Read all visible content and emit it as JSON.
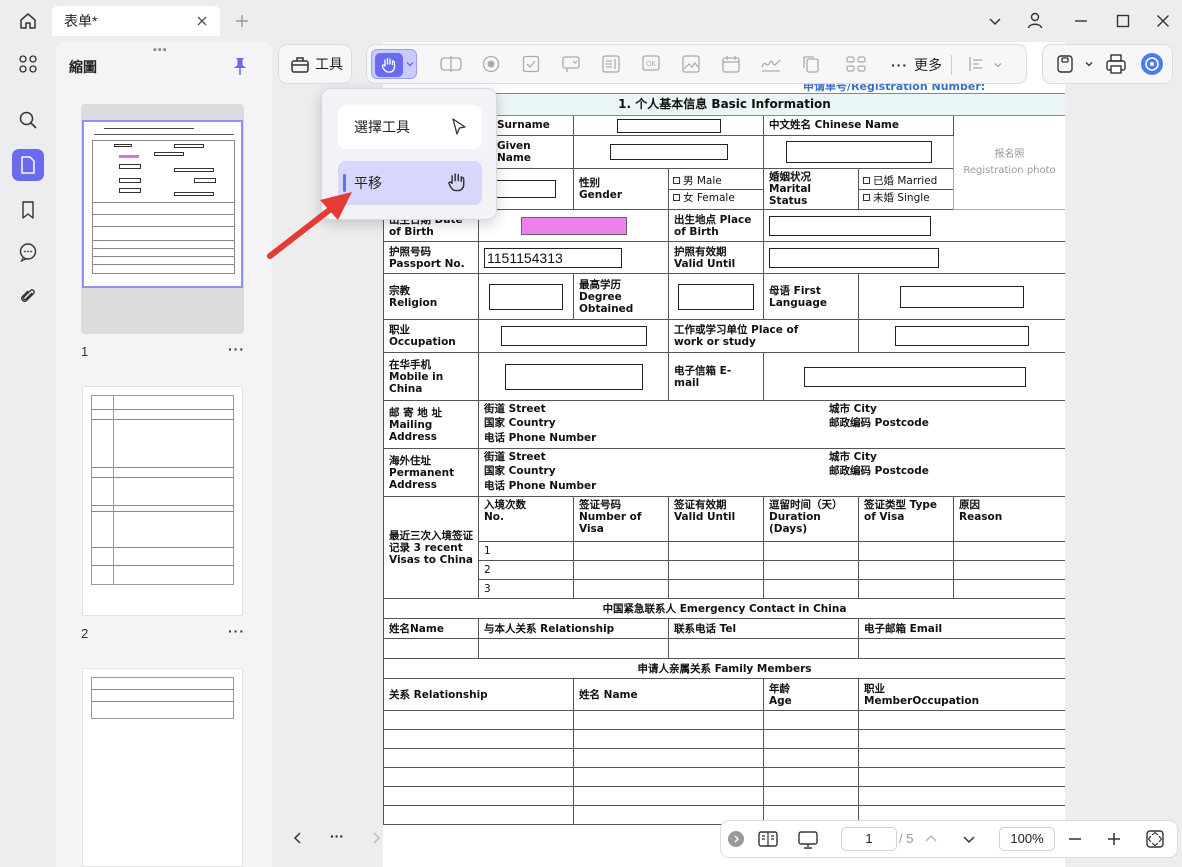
{
  "window": {
    "tab_title": "表单*",
    "controls": [
      "chevron-down-icon",
      "account-icon",
      "minimize-icon",
      "maximize-icon",
      "close-icon"
    ]
  },
  "rail": {
    "items": [
      "apps-icon",
      "search-icon",
      "pages-icon",
      "bookmark-icon",
      "comment-icon",
      "attachment-icon"
    ],
    "active": "pages-icon"
  },
  "thumbnails": {
    "title": "縮圖",
    "pages": [
      {
        "number": "1",
        "more": "···"
      },
      {
        "number": "2",
        "more": "···"
      },
      {
        "number": "",
        "more": ""
      }
    ]
  },
  "toolbar": {
    "tools_label": "工具",
    "more_label": "更多"
  },
  "popup": {
    "select_label": "選擇工具",
    "pan_label": "平移"
  },
  "document": {
    "header_text": "申请单号/Registration Number:",
    "section1": "1. 个人基本信息    Basic Information",
    "surname": "Surname",
    "given_name": "Given Name",
    "chinese_name": "中文姓名 Chinese Name",
    "photo": "报名照",
    "photo_en": "Registration photo",
    "gender": "性别 Gender",
    "male": "男 Male",
    "female": "女 Female",
    "marital": "婚姻状况 Marital Status",
    "married": "已婚 Married",
    "single": "未婚 Single",
    "dob": "出生日期 Date of Birth",
    "pob": "出生地点 Place of Birth",
    "passport": "护照号码 Passport No.",
    "passport_value": "1151154313",
    "valid_until": "护照有效期 Valid Until",
    "religion": "宗教 Religion",
    "degree": "最高学历 Degree Obtained",
    "first_lang": "母语 First Language",
    "occupation": "职业 Occupation",
    "workplace": "工作或学习单位 Place of work or study",
    "mobile": "在华手机 Mobile in China",
    "email": "电子信箱 E-mail",
    "mailing": "邮 寄 地 址 Mailing Address",
    "street": "街道 Street",
    "country": "国家 Country",
    "phone": "电话 Phone Number",
    "city": "城市 City",
    "postcode": "邮政编码 Postcode",
    "permanent": "海外住址 Permanent Address",
    "visas": "最近三次入境签证记录 3 recent Visas to China",
    "entry_no": "入境次数 No.",
    "visa_no": "签证号码 Number of Visa",
    "visa_valid": "签证有效期 Valid Until",
    "duration": "逗留时间（天） Duration (Days)",
    "visa_type": "签证类型 Type of Visa",
    "reason": "原因 Reason",
    "rows": [
      "1",
      "2",
      "3"
    ],
    "emergency": "中国紧急联系人      Emergency  Contact  in  China",
    "ec_name": "姓名Name",
    "ec_rel": "与本人关系 Relationship",
    "ec_tel": "联系电话 Tel",
    "ec_email": "电子邮箱 Email",
    "family": "申请人亲属关系      Family  Members",
    "fm_rel": "关系 Relationship",
    "fm_name": "姓名 Name",
    "fm_age": "年龄 Age",
    "fm_occ": "职业 MemberOccupation"
  },
  "bottombar": {
    "nav_more": "···",
    "current_page": "1",
    "total_pages": "/ 5",
    "zoom": "100%"
  }
}
